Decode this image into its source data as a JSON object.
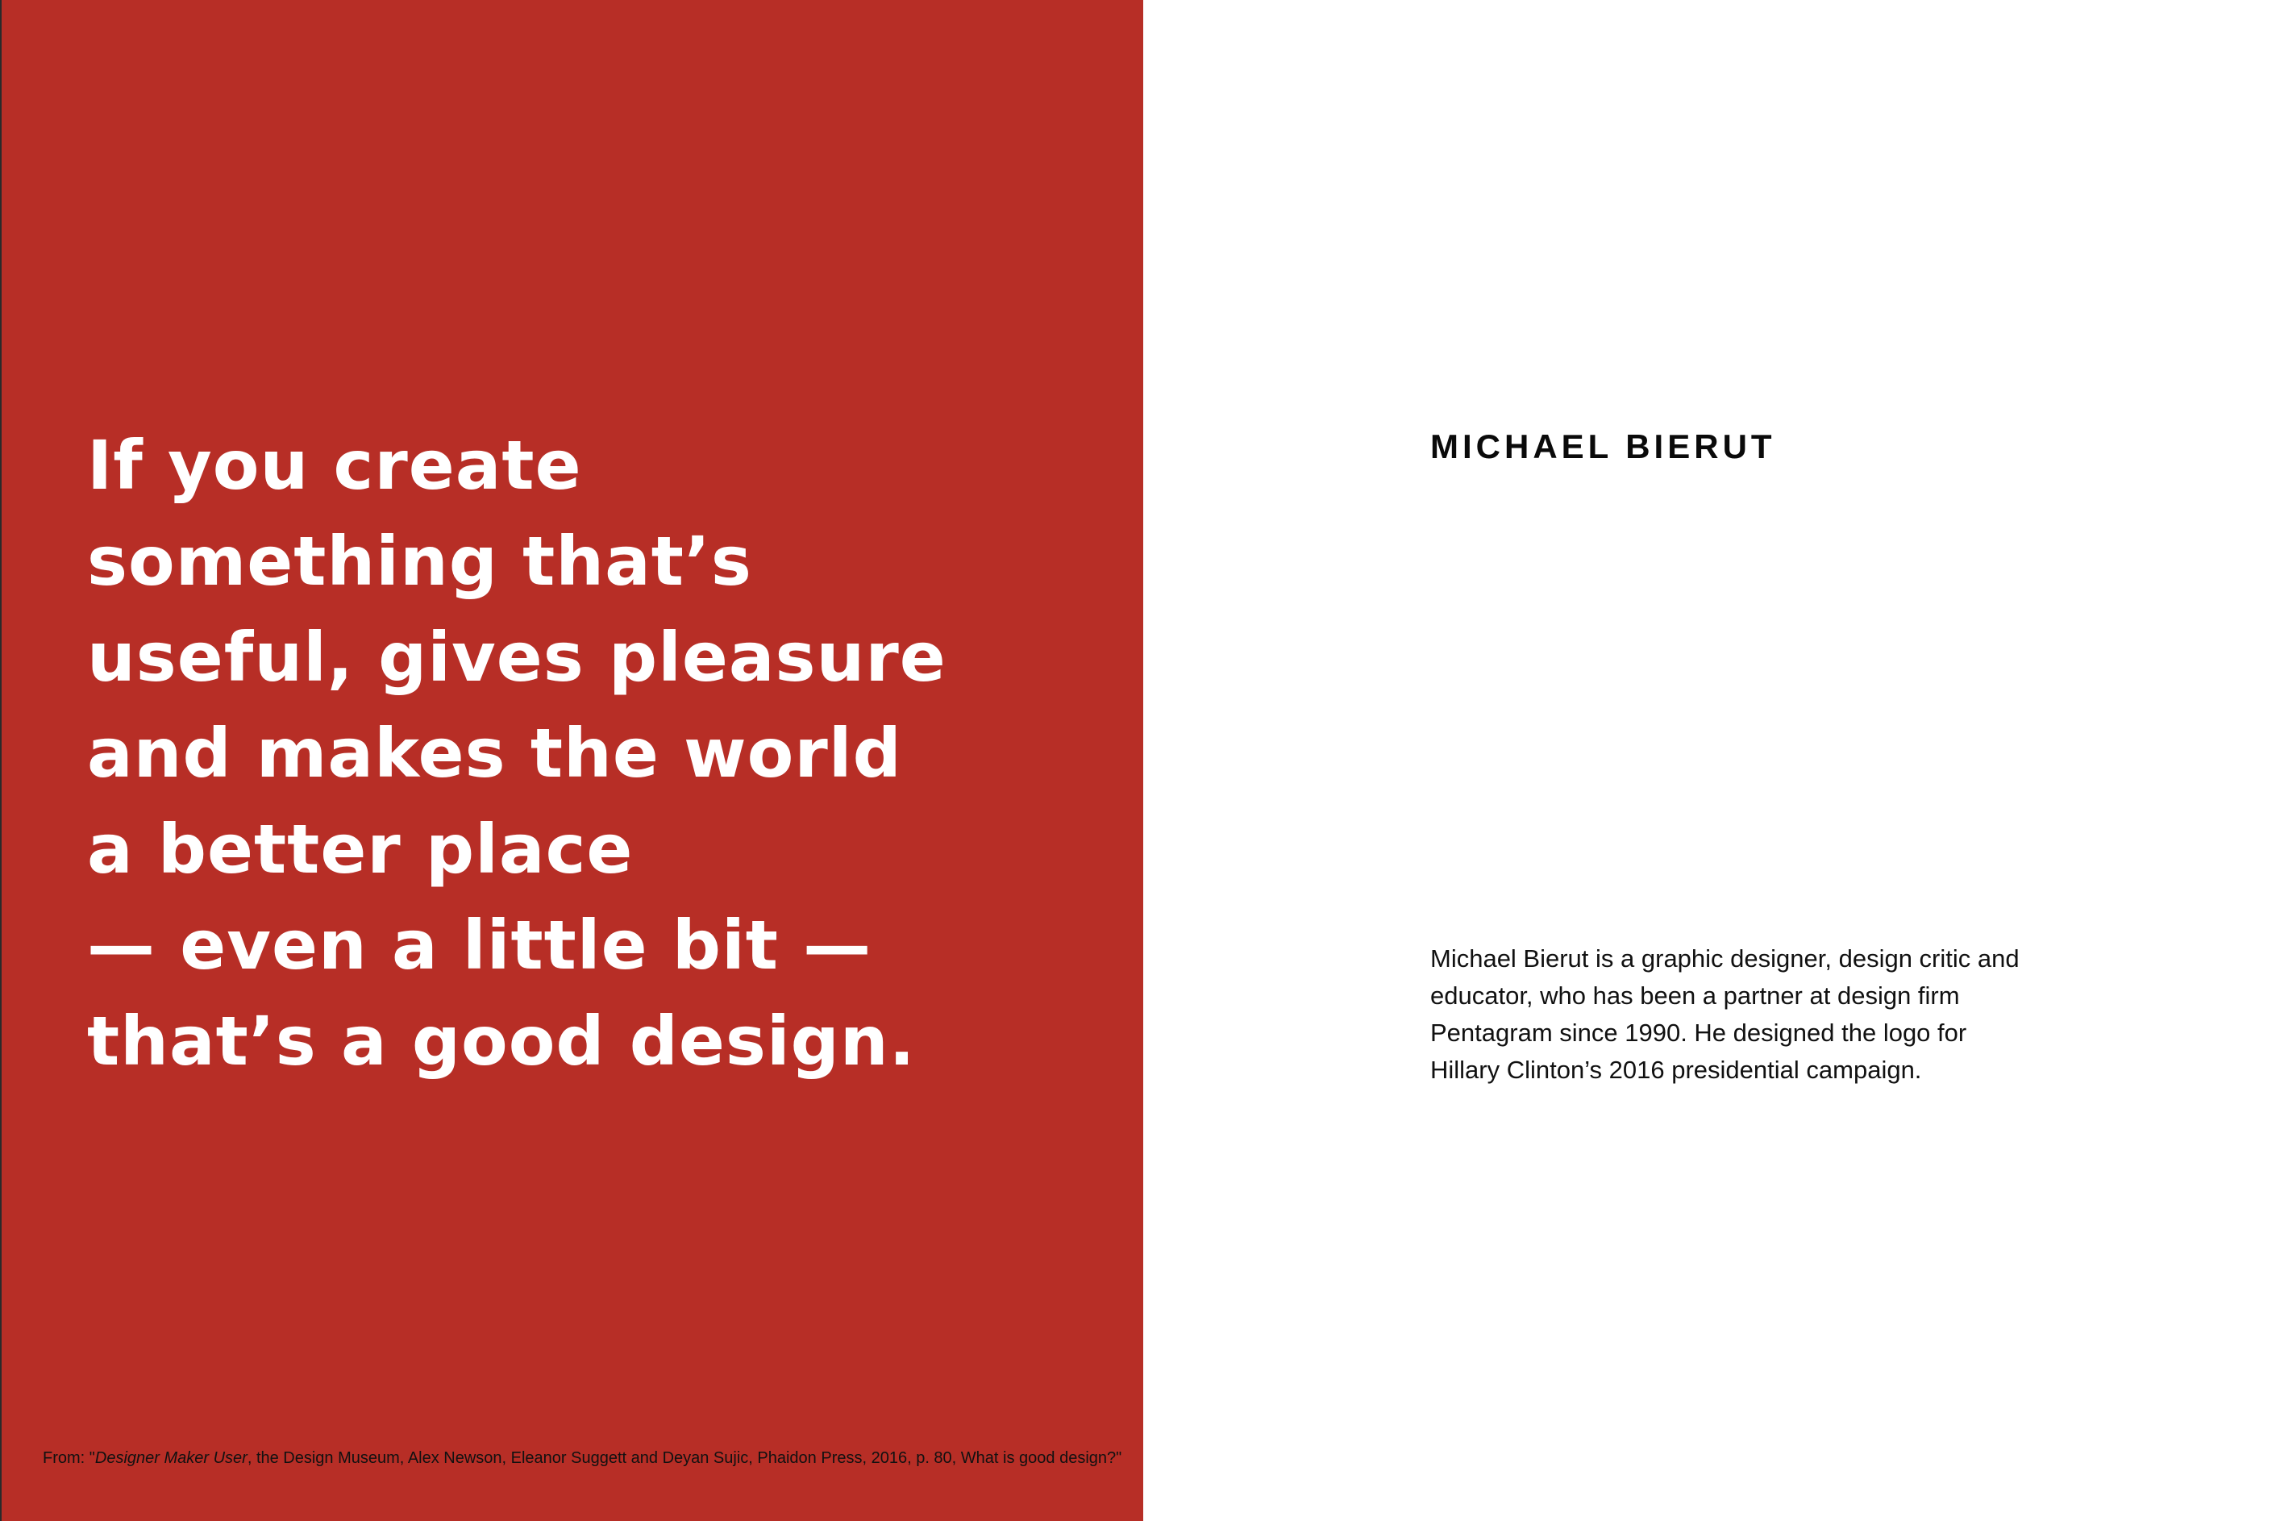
{
  "quote": {
    "lines": [
      "If you create",
      "something that’s",
      "useful, gives pleasure",
      "and makes the world",
      "a better place",
      "— even a little bit —",
      "that’s a good design."
    ]
  },
  "source": {
    "prefix": "From: \"",
    "book_title": "Designer Maker User",
    "rest": ", the Design Museum, Alex Newson, Eleanor Suggett and Deyan Sujic, Phaidon Press, 2016, p. 80, What is good design?\""
  },
  "person": {
    "name": "MICHAEL BIERUT",
    "bio_lines": [
      "Michael Bierut is a graphic designer, design critic and",
      "educator, who has been a partner at design firm",
      "Pentagram since 1990. He designed the logo for",
      "Hillary Clinton’s 2016 presidential campaign."
    ]
  },
  "colors": {
    "left_panel": "#b72e26",
    "quote_text": "#ffffff",
    "body_text": "#111111"
  }
}
